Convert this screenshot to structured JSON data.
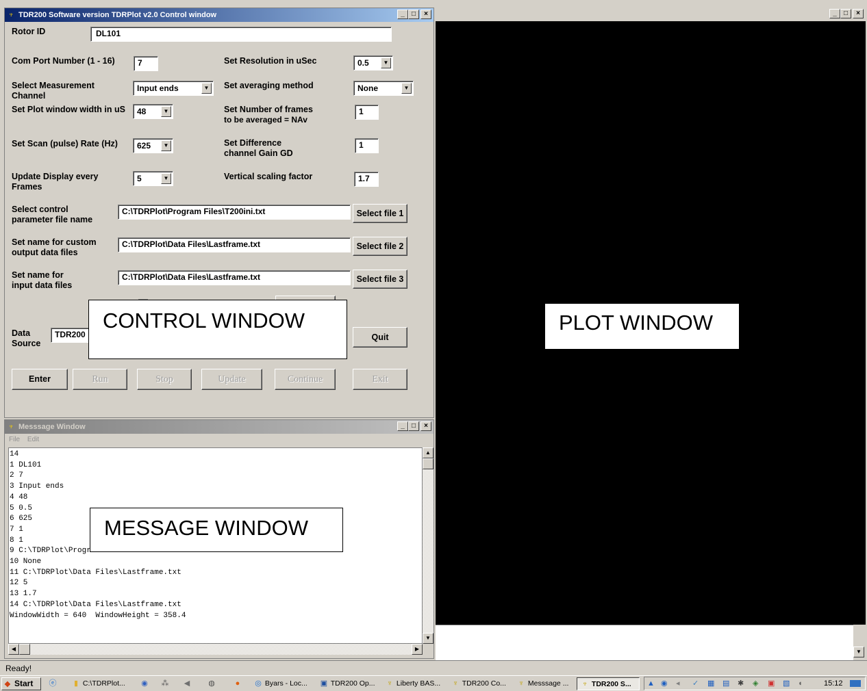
{
  "control_window": {
    "title": "TDR200 Software version TDRPlot v2.0    Control window",
    "rotor_id_label": "Rotor ID",
    "rotor_id_value": "DL101",
    "com_port_label": "Com Port Number (1 - 16)",
    "com_port_value": "7",
    "resolution_label": "Set Resolution in uSec",
    "resolution_value": "0.5",
    "measurement_channel_label_1": "Select Measurement",
    "measurement_channel_label_2": "Channel",
    "measurement_channel_value": "Input ends",
    "averaging_method_label": "Set averaging method",
    "averaging_method_value": "None",
    "plot_width_label": "Set Plot window width in uS",
    "plot_width_value": "48",
    "frames_averaged_label_1": "Set Number of frames",
    "frames_averaged_label_2": "to be averaged = NAv",
    "frames_averaged_value": "1",
    "scan_rate_label": "Set Scan (pulse) Rate (Hz)",
    "scan_rate_value": "625",
    "difference_gain_label_1": "Set Difference",
    "difference_gain_label_2": "channel Gain GD",
    "difference_gain_value": "1",
    "update_display_label_1": "Update Display every",
    "update_display_label_2": "Frames",
    "update_display_value": "5",
    "vertical_scaling_label": "Vertical scaling factor",
    "vertical_scaling_value": "1.7",
    "control_file_label_1": "Select control",
    "control_file_label_2": "parameter file name",
    "control_file_value": "C:\\TDRPlot\\Program Files\\T200ini.txt",
    "select_file_1": "Select file 1",
    "output_file_label_1": "Set name for custom",
    "output_file_label_2": "output data files",
    "output_file_value": "C:\\TDRPlot\\Data Files\\Lastframe.txt",
    "select_file_2": "Select file 2",
    "input_file_label_1": "Set name for",
    "input_file_label_2": "input data files",
    "input_file_value": "C:\\TDRPlot\\Data Files\\Lastframe.txt",
    "select_file_3": "Select file 3",
    "data_source_label_1": "Data",
    "data_source_label_2": "Source",
    "data_source_value": "TDR200",
    "quit": "Quit",
    "enter": "Enter",
    "run": "Run",
    "stop": "Stop",
    "update": "Update",
    "continue": "Continue",
    "exit": "Exit"
  },
  "overlays": {
    "control": "CONTROL WINDOW",
    "message": "MESSAGE WINDOW",
    "plot": "PLOT WINDOW"
  },
  "message_window": {
    "title": "Messsage Window",
    "menu_file": "File",
    "menu_edit": "Edit",
    "text": "14\n1 DL101\n2 7\n3 Input ends\n4 48\n5 0.5\n6 625\n7 1\n8 1\n9 C:\\TDRPlot\\Program Files\\T200ini.txt\n10 None\n11 C:\\TDRPlot\\Data Files\\Lastframe.txt\n12 5\n13 1.7\n14 C:\\TDRPlot\\Data Files\\Lastframe.txt\nWindowWidth = 640  WindowHeight = 358.4"
  },
  "status_bar": {
    "text": "Ready!"
  },
  "taskbar": {
    "start": "Start",
    "items": [
      "C:\\TDRPlot...",
      "Byars - Loc...",
      "TDR200 Op...",
      "Liberty BAS...",
      "TDR200 Co...",
      "Messsage ...",
      "TDR200 S..."
    ],
    "clock": "15:12"
  },
  "colors": {
    "title_active": "#0a246a",
    "window_face": "#d4d0c8",
    "plot_background": "#000000"
  }
}
